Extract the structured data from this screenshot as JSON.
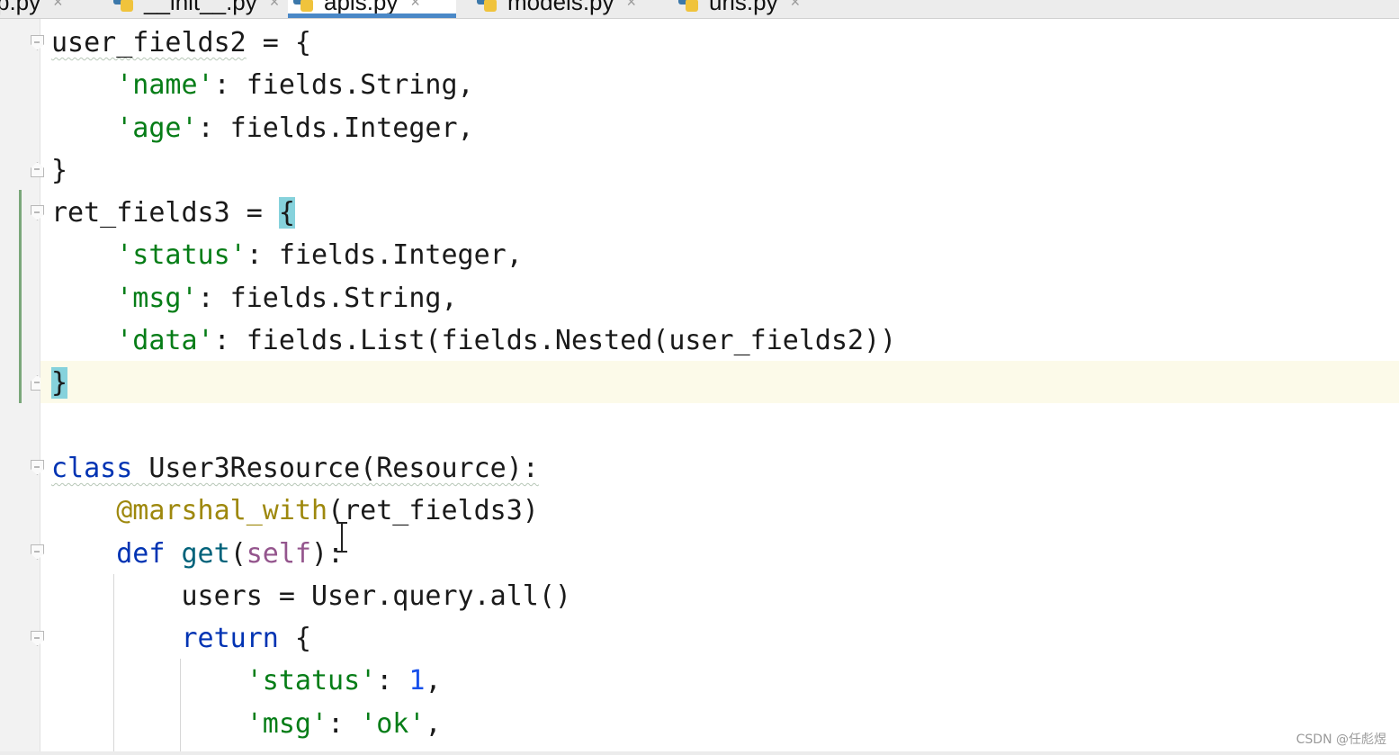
{
  "tabs": [
    {
      "label": "p.py",
      "active": false
    },
    {
      "label": "__init__.py",
      "active": false
    },
    {
      "label": "apis.py",
      "active": true
    },
    {
      "label": "models.py",
      "active": false
    },
    {
      "label": "urls.py",
      "active": false
    }
  ],
  "tab_close_glyph": "×",
  "code": {
    "l1_name": "user_fields2",
    "l1_rest": " = {",
    "l2_key": "'name'",
    "l2_rest": ": fields.String,",
    "l3_key": "'age'",
    "l3_rest": ": fields.Integer,",
    "l4": "}",
    "l5_name": "ret_fields3 = ",
    "l5_brace": "{",
    "l6_key": "'status'",
    "l6_rest": ": fields.Integer,",
    "l7_key": "'msg'",
    "l7_rest": ": fields.String,",
    "l8_key": "'data'",
    "l8_rest": ": fields.List(fields.Nested(user_fields2))",
    "l9_brace": "}",
    "l11_kw": "class",
    "l11_rest": " User3Resource(Resource):",
    "l12_deco": "@marshal_with",
    "l12_rest": "(ret_fields3)",
    "l13_kw": "def",
    "l13_fn": "get",
    "l13_open": "(",
    "l13_self": "self",
    "l13_close": "):",
    "l14": "users = User.query.all()",
    "l15_kw": "return",
    "l15_rest": " {",
    "l16_key": "'status'",
    "l16_mid": ": ",
    "l16_num": "1",
    "l16_end": ",",
    "l17_key": "'msg'",
    "l17_mid": ": ",
    "l17_val": "'ok'",
    "l17_end": ","
  },
  "watermark": "CSDN @任彪煜",
  "colors": {
    "string": "#067d17",
    "keyword": "#0033b3",
    "number": "#1750eb",
    "decorator": "#9e880d",
    "self": "#94558d",
    "brace_match": "#86d2dc",
    "current_line": "#fcfae9",
    "active_tab_underline": "#4a88c7"
  }
}
